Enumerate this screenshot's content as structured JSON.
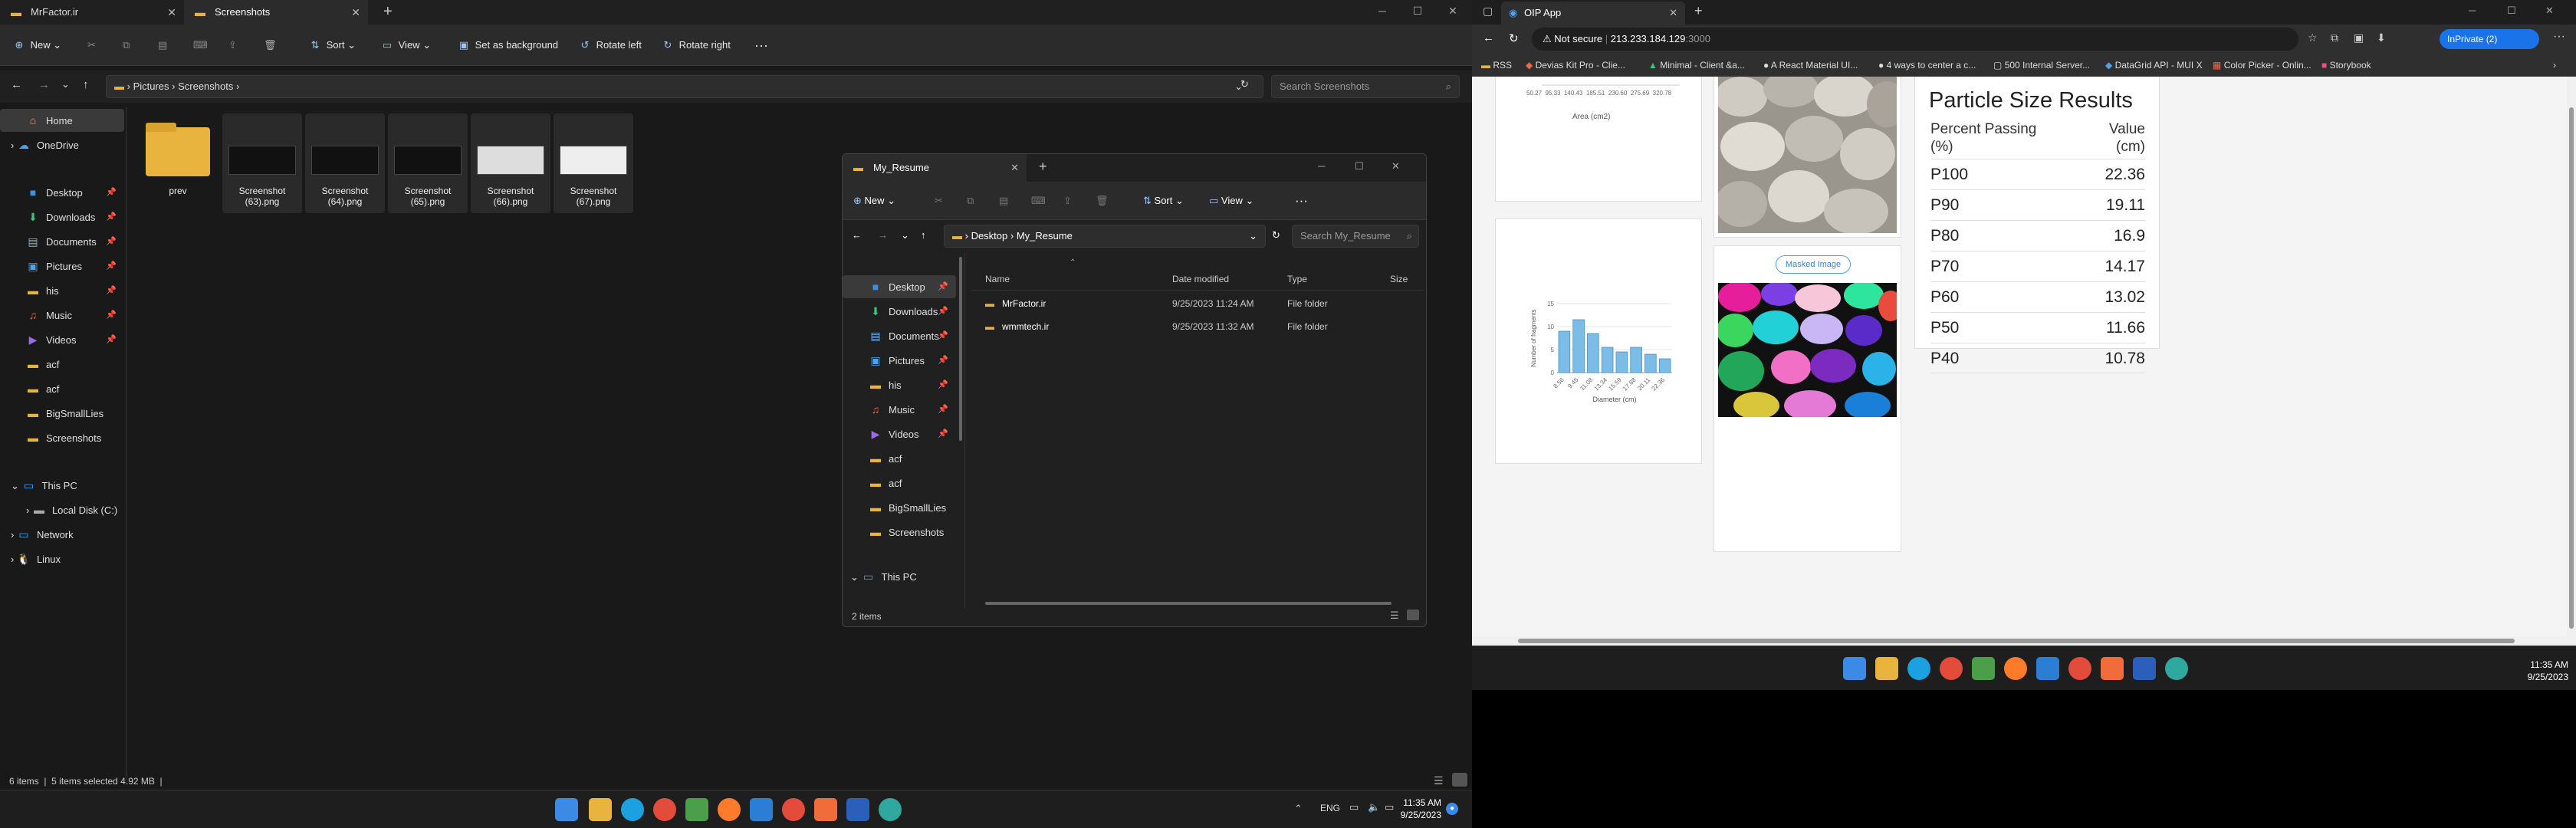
{
  "explorer": {
    "tabs": [
      "MrFactor.ir",
      "Screenshots"
    ],
    "new_label": "New",
    "sort_label": "Sort",
    "view_label": "View",
    "set_bg_label": "Set as background",
    "rotate_left_label": "Rotate left",
    "rotate_right_label": "Rotate right",
    "breadcrumb": [
      "Pictures",
      "Screenshots"
    ],
    "search_placeholder": "Search Screenshots",
    "nav": {
      "home": "Home",
      "onedrive": "OneDrive",
      "pinned": [
        "Desktop",
        "Downloads",
        "Documents",
        "Pictures",
        "his",
        "Music",
        "Videos"
      ],
      "folders": [
        "acf",
        "acf",
        "BigSmallLies",
        "Screenshots"
      ],
      "this_pc": "This PC",
      "local_disk": "Local Disk (C:)",
      "network": "Network",
      "linux": "Linux"
    },
    "files": [
      {
        "name": "prev",
        "type": "folder"
      },
      {
        "name": "Screenshot (63).png"
      },
      {
        "name": "Screenshot (64).png"
      },
      {
        "name": "Screenshot (65).png"
      },
      {
        "name": "Screenshot (66).png"
      },
      {
        "name": "Screenshot (67).png"
      }
    ],
    "status": {
      "items": "6 items",
      "selected": "5 items selected  4.92 MB"
    }
  },
  "inner": {
    "title": "My_Resume",
    "new_label": "New",
    "sort_label": "Sort",
    "view_label": "View",
    "breadcrumb": [
      "Desktop",
      "My_Resume"
    ],
    "search_placeholder": "Search My_Resume",
    "columns": [
      "Name",
      "Date modified",
      "Type",
      "Size"
    ],
    "rows": [
      {
        "name": "MrFactor.ir",
        "date": "9/25/2023 11:24 AM",
        "type": "File folder"
      },
      {
        "name": "wmmtech.ir",
        "date": "9/25/2023 11:32 AM",
        "type": "File folder"
      }
    ],
    "nav": [
      "Desktop",
      "Downloads",
      "Documents",
      "Pictures",
      "his",
      "Music",
      "Videos",
      "acf",
      "acf",
      "BigSmallLies",
      "Screenshots"
    ],
    "this_pc": "This PC",
    "status": "2 items"
  },
  "taskbar_left": {
    "time": "11:35 AM",
    "date": "9/25/2023",
    "lang": "ENG"
  },
  "browser": {
    "tab_title": "OIP App",
    "not_secure": "Not secure",
    "url": "213.233.184.129",
    "port": ":3000",
    "inprivate": "InPrivate (2)",
    "bookmarks": [
      "RSS",
      "Devias Kit Pro - Clie...",
      "Minimal - Client &a...",
      "A React Material UI...",
      "4 ways to center a c...",
      "500 Internal Server...",
      "DataGrid API - MUI X",
      "Color Picker - Onlin...",
      "Storybook"
    ],
    "chart1_xlabel": "Area (cm2)",
    "chart1_ticks": [
      "50.27",
      "95.33",
      "140.43",
      "185.51",
      "230.60",
      "275.69",
      "320.78"
    ],
    "masked_label": "Masked Image",
    "results": {
      "title": "Particle Size Results",
      "col1": "Percent Passing (%)",
      "col2": "Value (cm)",
      "rows": [
        {
          "p": "P100",
          "v": "22.36"
        },
        {
          "p": "P90",
          "v": "19.11"
        },
        {
          "p": "P80",
          "v": "16.9"
        },
        {
          "p": "P70",
          "v": "14.17"
        },
        {
          "p": "P60",
          "v": "13.02"
        },
        {
          "p": "P50",
          "v": "11.66"
        },
        {
          "p": "P40",
          "v": "10.78"
        }
      ]
    }
  },
  "taskbar_right": {
    "time": "11:35 AM",
    "date": "9/25/2023"
  },
  "chart_data": {
    "type": "bar",
    "categories": [
      "8.56",
      "9.45",
      "11.08",
      "13.34",
      "15.59",
      "17.88",
      "20.11",
      "22.36"
    ],
    "values": [
      9,
      11.5,
      8.5,
      5.5,
      4.5,
      5.5,
      4,
      3
    ],
    "xlabel": "Diameter (cm)",
    "ylabel": "Number of fragments",
    "yticks": [
      "0",
      "5",
      "10",
      "15"
    ],
    "ylim": [
      0,
      15
    ],
    "color": "#7bbde6"
  }
}
